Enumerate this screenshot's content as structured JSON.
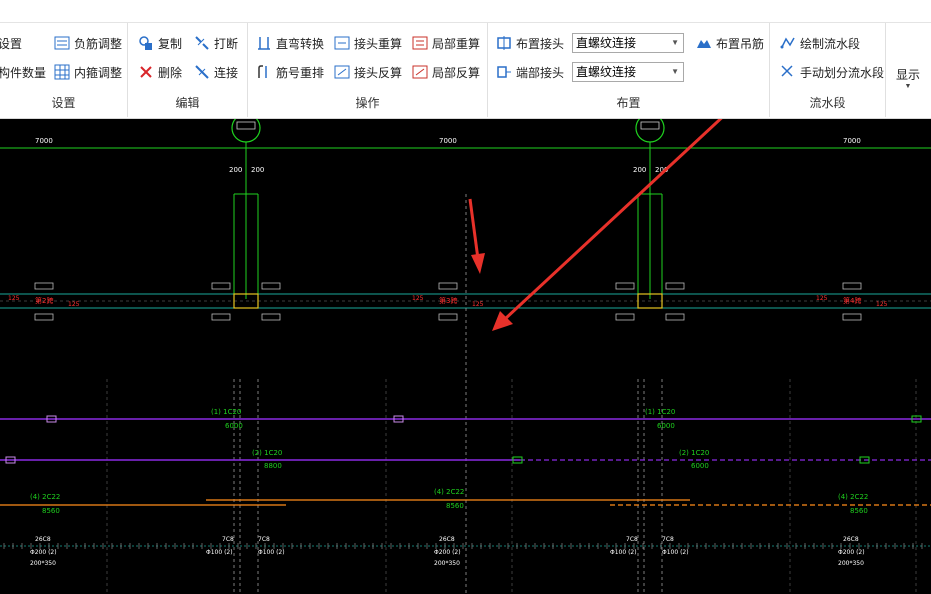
{
  "ribbon": {
    "settings": {
      "title": "设置",
      "items": [
        "设置",
        "构件数量",
        "负筋调整",
        "内箍调整"
      ]
    },
    "edit": {
      "title": "编辑",
      "items": [
        "复制",
        "删除",
        "打断",
        "连接"
      ]
    },
    "operation": {
      "title": "操作",
      "items": [
        "直弯转换",
        "接头重算",
        "局部重算",
        "筋号重排",
        "接头反算",
        "局部反算"
      ]
    },
    "layout": {
      "title": "布置",
      "items": [
        "布置接头",
        "端部接头",
        "布置吊筋"
      ],
      "select1": "直螺纹连接",
      "select2": "直螺纹连接"
    },
    "flow": {
      "title": "流水段",
      "items": [
        "绘制流水段",
        "手动划分流水段"
      ]
    },
    "display": {
      "label": "显示"
    }
  },
  "drawing": {
    "spans": [
      "7000",
      "7000",
      "7000"
    ],
    "dims": [
      "200",
      "200",
      "200",
      "200"
    ],
    "axis_labels": [
      "第2跨",
      "第3跨",
      "第4跨"
    ],
    "small_labels": [
      "125",
      "125",
      "125",
      "125",
      "125",
      "125"
    ],
    "rebar_top1": {
      "label": "(1) 1C20",
      "len": "6000"
    },
    "rebar_top1b": {
      "label": "(1) 1C20",
      "len": "6000"
    },
    "rebar_top2": {
      "label": "(2) 1C20",
      "len": "8800"
    },
    "rebar_top2b": {
      "label": "(2) 1C20",
      "len": "6000"
    },
    "rebar_bot1": {
      "label": "(4) 2C22",
      "len": "8560"
    },
    "rebar_bot2": {
      "label": "(4) 2C22",
      "len": "8560"
    },
    "rebar_bot3": {
      "label": "(4) 2C22",
      "len": "8560"
    },
    "stirrups": [
      {
        "n": "26C8",
        "s": "Φ200 (2)",
        "d": "200*350"
      },
      {
        "n": "7C8",
        "s": "Φ100 (2)",
        "d": ""
      },
      {
        "n": "7C8",
        "s": "Φ100 (2)",
        "d": ""
      },
      {
        "n": "26C8",
        "s": "Φ200 (2)",
        "d": "200*350"
      },
      {
        "n": "7C8",
        "s": "Φ100 (2)",
        "d": ""
      },
      {
        "n": "7C8",
        "s": "Φ100 (2)",
        "d": ""
      },
      {
        "n": "26C8",
        "s": "Φ200 (2)",
        "d": "200*350"
      }
    ]
  },
  "colors": {
    "green": "#1fd21f",
    "teal": "#1aa89a",
    "purple": "#8a2be2",
    "orange": "#ff8c1a",
    "red": "#ff3030",
    "annotation": "#e8312a"
  }
}
